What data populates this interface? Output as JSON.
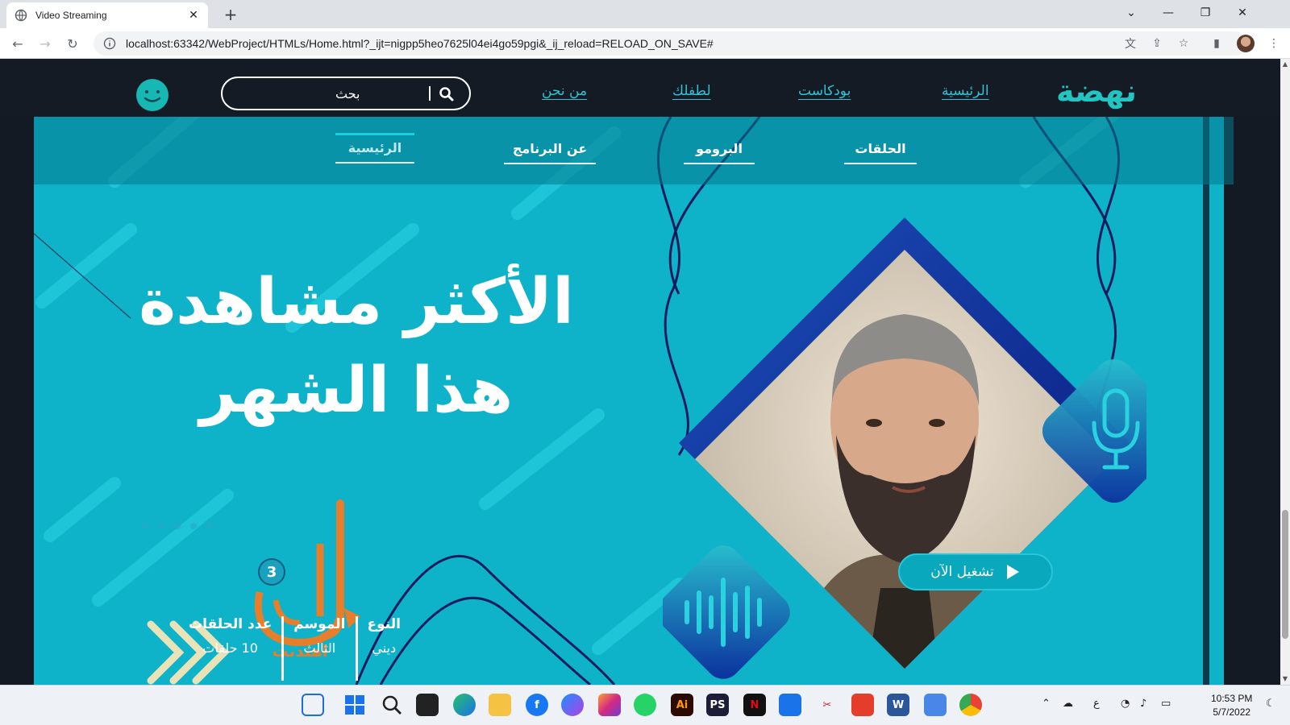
{
  "browser": {
    "tab_title": "Video Streaming",
    "url": "localhost:63342/WebProject/HTMLs/Home.html?_ijt=nigpp5heo7625l04ei4go59pgi&_ij_reload=RELOAD_ON_SAVE#"
  },
  "site": {
    "logo": "نهضة",
    "nav": [
      "الرئيسية",
      "بودكاست",
      "لطفلك",
      "من نحن"
    ],
    "search_placeholder": "بحث"
  },
  "program_nav": [
    "الحلقات",
    "البرومو",
    "عن البرنامج",
    "الرئيسية"
  ],
  "hero": {
    "headline_line1": "الأكثر مشاهدة",
    "headline_line2": "هذا الشهر",
    "brand_subtitle": "اهتديت",
    "brand_badge": "3",
    "play_label": "تشغيل الآن",
    "meta": [
      {
        "key": "النوع",
        "value": "ديني"
      },
      {
        "key": "الموسم",
        "value": "الثالث"
      },
      {
        "key": "عدد الحلقات",
        "value": "10 حلقات"
      }
    ]
  },
  "clock": {
    "time": "10:53 PM",
    "date": "5/7/2022"
  },
  "tray_lang": "ع",
  "colors": {
    "accent": "#0fb3c9",
    "logo": "#21c6c2",
    "navy": "#0a1f7a",
    "page_bg": "#131a24"
  }
}
